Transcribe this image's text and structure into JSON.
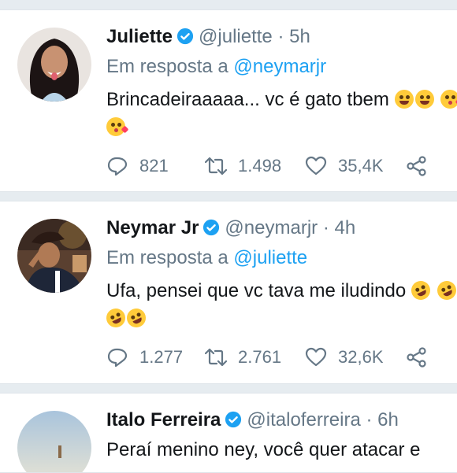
{
  "tweets": [
    {
      "name": "Juliette",
      "handle": "@juliette",
      "separator": "·",
      "time": "5h",
      "reply_prefix": "Em resposta a",
      "reply_to": "@neymarjr",
      "text": "Brincadeiraaaaa... vc é gato tbem",
      "replies": "821",
      "retweets": "1.498",
      "likes": "35,4K"
    },
    {
      "name": "Neymar Jr",
      "handle": "@neymarjr",
      "separator": "·",
      "time": "4h",
      "reply_prefix": "Em resposta a",
      "reply_to": "@juliette",
      "text": "Ufa, pensei que vc tava me iludindo",
      "replies": "1.277",
      "retweets": "2.761",
      "likes": "32,6K"
    },
    {
      "name": "Italo Ferreira",
      "handle": "@italoferreira",
      "separator": "·",
      "time": "6h",
      "text": "Peraí menino ney, você quer atacar e"
    }
  ],
  "colors": {
    "link": "#1da1f2",
    "muted": "#657786",
    "text": "#14171a",
    "verified": "#1da1f2"
  },
  "icons": [
    "verified-badge-icon",
    "reply-icon",
    "retweet-icon",
    "like-icon",
    "share-icon"
  ]
}
